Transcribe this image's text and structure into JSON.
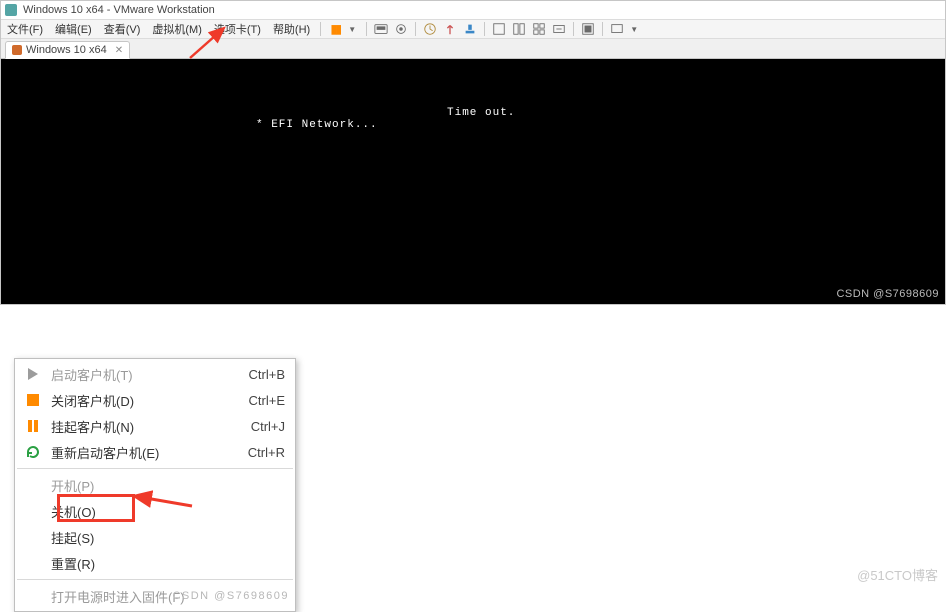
{
  "titlebar": {
    "text": "Windows 10 x64 - VMware Workstation"
  },
  "menubar": {
    "file": "文件(F)",
    "edit": "编辑(E)",
    "view": "查看(V)",
    "vm": "虚拟机(M)",
    "tabs": "选项卡(T)",
    "help": "帮助(H)"
  },
  "vmtab": {
    "label": "Windows 10 x64"
  },
  "vm_screen": {
    "efi": "* EFI Network...",
    "timeout": "Time out.",
    "watermark_csdn": "CSDN @S7698609"
  },
  "context_menu": {
    "start_guest": {
      "label": "启动客户机(T)",
      "shortcut": "Ctrl+B"
    },
    "shutdown_guest": {
      "label": "关闭客户机(D)",
      "shortcut": "Ctrl+E"
    },
    "suspend_guest": {
      "label": "挂起客户机(N)",
      "shortcut": "Ctrl+J"
    },
    "restart_guest": {
      "label": "重新启动客户机(E)",
      "shortcut": "Ctrl+R"
    },
    "power_on": {
      "label": "开机(P)"
    },
    "power_off": {
      "label": "关机(O)"
    },
    "suspend": {
      "label": "挂起(S)"
    },
    "reset": {
      "label": "重置(R)"
    },
    "power_on_firmware": {
      "label": "打开电源时进入固件(F)"
    },
    "watermark_csdn": "CSDN @S7698609"
  },
  "watermarks": {
    "cto": "@51CTO博客"
  }
}
